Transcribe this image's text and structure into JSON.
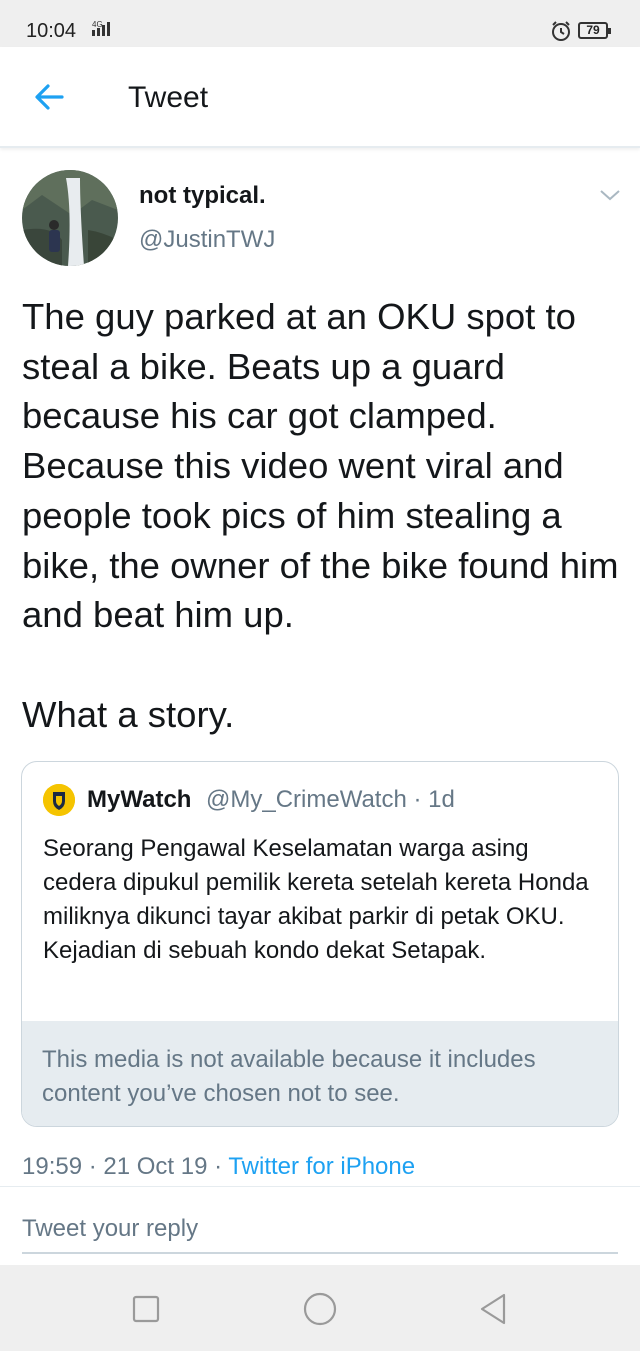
{
  "status_bar": {
    "time": "10:04",
    "network": "4G",
    "battery": "79",
    "icons": [
      "signal-icon",
      "alarm-icon",
      "battery-icon"
    ]
  },
  "header": {
    "title": "Tweet",
    "back_icon": "arrow-left-icon"
  },
  "tweet": {
    "display_name": "not typical.",
    "handle": "@JustinTWJ",
    "text": "The guy parked at an OKU spot to steal a bike. Beats up a guard because his car got clamped. Because this video went viral and people took pics of him stealing a bike, the owner of the bike found him and beat him up.\n\nWhat a story.",
    "timestamp": "19:59 · 21 Oct 19 · ",
    "source": "Twitter for iPhone"
  },
  "quoted_tweet": {
    "display_name": "MyWatch",
    "meta": "@My_CrimeWatch · 1d",
    "text": "Seorang Pengawal Keselamatan warga asing cedera dipukul pemilik kereta setelah kereta Honda miliknya dikunci tayar akibat parkir di petak OKU. Kejadian di sebuah kondo dekat Setapak.",
    "withheld_notice": "This media is not available because it includes content you’ve chosen not to see."
  },
  "reply": {
    "placeholder": "Tweet your reply"
  },
  "colors": {
    "accent": "#1da1f2",
    "secondary_text": "#657786",
    "border": "#ccd6dd"
  }
}
